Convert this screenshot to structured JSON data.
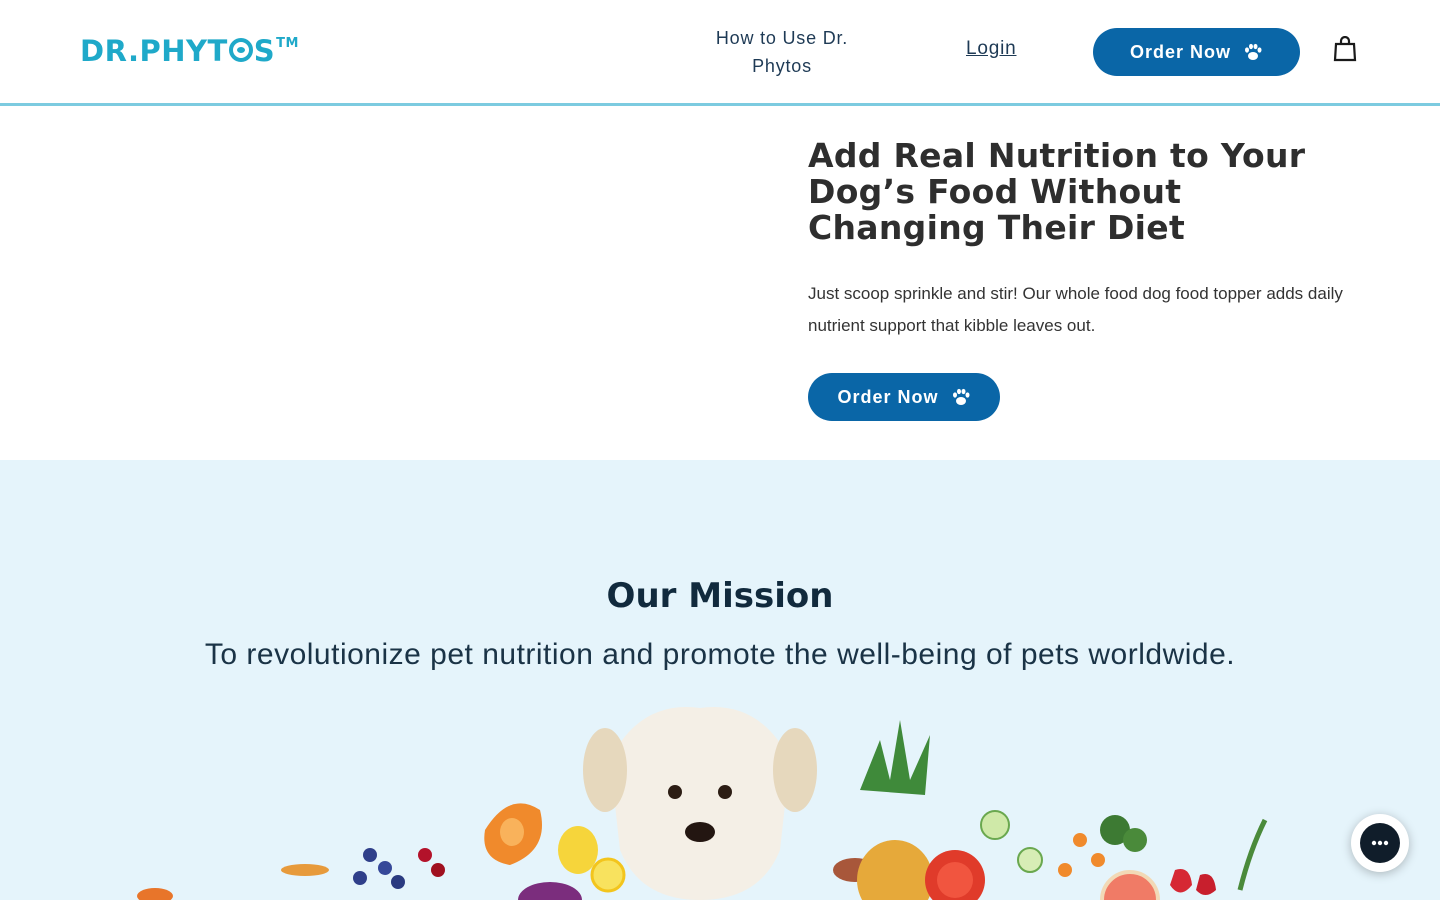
{
  "header": {
    "logo": {
      "text": "DR.PHYT",
      "text_end": "S",
      "tm": "TM"
    },
    "nav_how_line1": "How to Use Dr.",
    "nav_how_line2": "Phytos",
    "nav_login": "Login",
    "order_button": "Order Now",
    "cart_icon": "shopping-bag-icon"
  },
  "hero": {
    "title": "Add Real Nutrition to Your Dog’s Food Without Changing Their Diet",
    "description": "Just scoop sprinkle and stir! Our whole food dog food topper adds daily nutrient support that kibble leaves out.",
    "order_button": "Order Now"
  },
  "mission": {
    "title": "Our Mission",
    "text": "To revolutionize pet nutrition and promote the well-being of pets worldwide."
  },
  "chat_widget": {
    "icon": "chat-bubble-icon"
  },
  "colors": {
    "brand": "#1fa9c9",
    "button": "#0a66a7",
    "mission_bg": "#e5f4fb",
    "header_border": "#7ccbe0"
  }
}
